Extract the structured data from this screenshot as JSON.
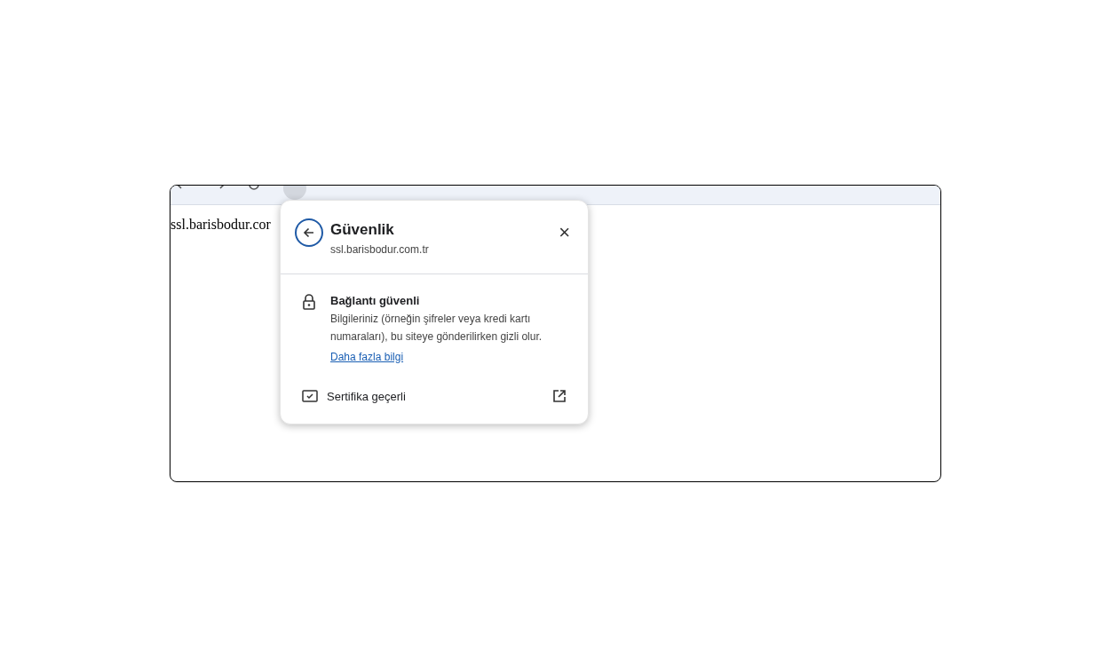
{
  "page": {
    "text": "ssl.barisbodur.cor"
  },
  "popup": {
    "title": "Güvenlik",
    "subtitle": "ssl.barisbodur.com.tr",
    "close": "×",
    "connection": {
      "title": "Bağlantı güvenli",
      "description": "Bilgileriniz (örneğin şifreler veya kredi kartı numaraları), bu siteye gönderilirken gizli olur.",
      "link": "Daha fazla bilgi"
    },
    "certificate": {
      "label": "Sertifika geçerli"
    }
  }
}
